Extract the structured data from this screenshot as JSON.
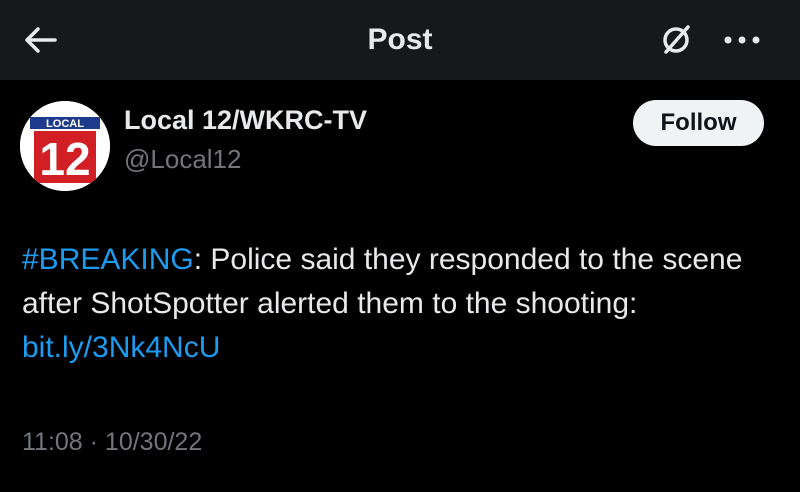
{
  "header": {
    "title": "Post",
    "back_icon": "arrow-left-icon",
    "grok_icon": "grok-icon",
    "more_icon": "more-horizontal-icon"
  },
  "author": {
    "name": "Local 12/WKRC-TV",
    "handle": "@Local12",
    "avatar": {
      "logo_top_text": "LOCAL",
      "logo_number": "12",
      "colors": {
        "red": "#d21f26",
        "blue": "#1e3a8a"
      }
    },
    "follow_label": "Follow"
  },
  "post": {
    "hashtag": "#BREAKING",
    "text_after_hashtag": ": Police said they responded to the scene after ShotSpotter alerted them to the shooting: ",
    "link": "bit.ly/3Nk4NcU",
    "timestamp": "11:08 · 10/30/22"
  },
  "colors": {
    "background": "#000000",
    "header_background": "#16181c",
    "text_primary": "#e7e9ea",
    "text_secondary": "#71767b",
    "link": "#1d9bf0",
    "follow_bg": "#eff3f4"
  }
}
